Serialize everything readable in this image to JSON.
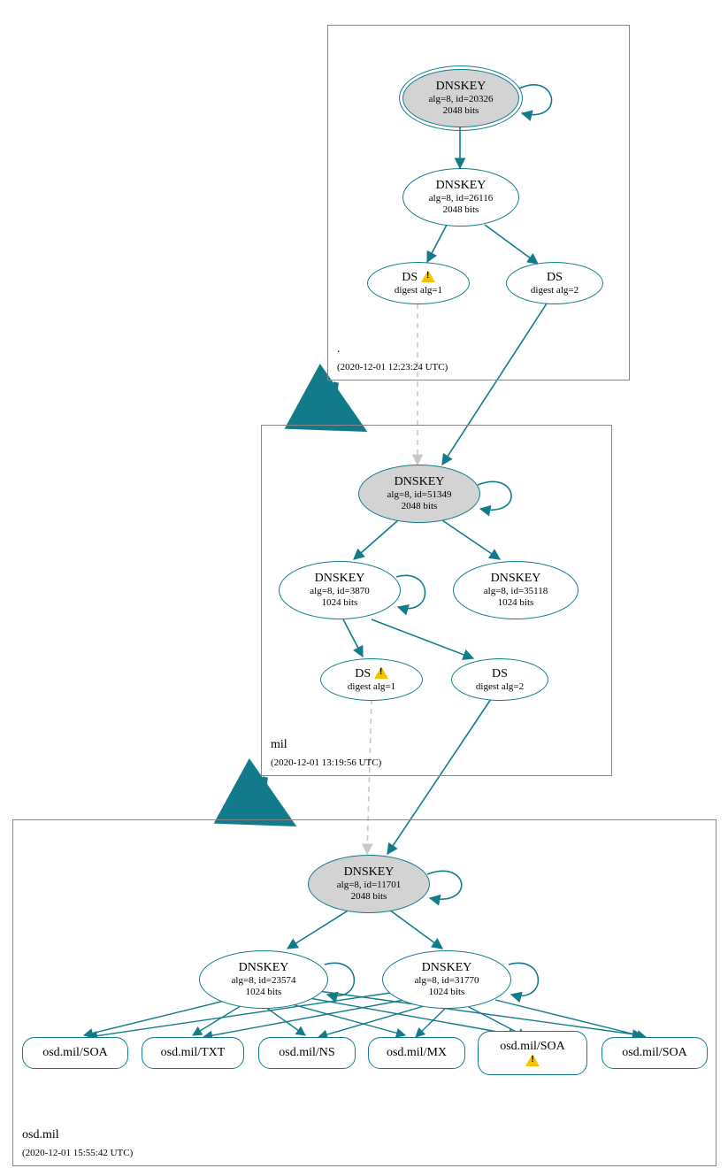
{
  "colors": {
    "stroke": "#117b8c",
    "ksk_fill": "#d3d3d3"
  },
  "zones": {
    "root": {
      "label": ".",
      "timestamp": "(2020-12-01 12:23:24 UTC)"
    },
    "mil": {
      "label": "mil",
      "timestamp": "(2020-12-01 13:19:56 UTC)"
    },
    "osd": {
      "label": "osd.mil",
      "timestamp": "(2020-12-01 15:55:42 UTC)"
    }
  },
  "nodes": {
    "root_ksk": {
      "title": "DNSKEY",
      "sub1": "alg=8, id=20326",
      "sub2": "2048 bits"
    },
    "root_zsk": {
      "title": "DNSKEY",
      "sub1": "alg=8, id=26116",
      "sub2": "2048 bits"
    },
    "root_ds1": {
      "title": "DS",
      "sub1": "digest alg=1",
      "warn": true
    },
    "root_ds2": {
      "title": "DS",
      "sub1": "digest alg=2"
    },
    "mil_ksk": {
      "title": "DNSKEY",
      "sub1": "alg=8, id=51349",
      "sub2": "2048 bits"
    },
    "mil_zsk1": {
      "title": "DNSKEY",
      "sub1": "alg=8, id=3870",
      "sub2": "1024 bits"
    },
    "mil_zsk2": {
      "title": "DNSKEY",
      "sub1": "alg=8, id=35118",
      "sub2": "1024 bits"
    },
    "mil_ds1": {
      "title": "DS",
      "sub1": "digest alg=1",
      "warn": true
    },
    "mil_ds2": {
      "title": "DS",
      "sub1": "digest alg=2"
    },
    "osd_ksk": {
      "title": "DNSKEY",
      "sub1": "alg=8, id=11701",
      "sub2": "2048 bits"
    },
    "osd_zsk1": {
      "title": "DNSKEY",
      "sub1": "alg=8, id=23574",
      "sub2": "1024 bits"
    },
    "osd_zsk2": {
      "title": "DNSKEY",
      "sub1": "alg=8, id=31770",
      "sub2": "1024 bits"
    },
    "rr_soa1": "osd.mil/SOA",
    "rr_txt": "osd.mil/TXT",
    "rr_ns": "osd.mil/NS",
    "rr_mx": "osd.mil/MX",
    "rr_soa2": "osd.mil/SOA",
    "rr_soa3": "osd.mil/SOA"
  }
}
